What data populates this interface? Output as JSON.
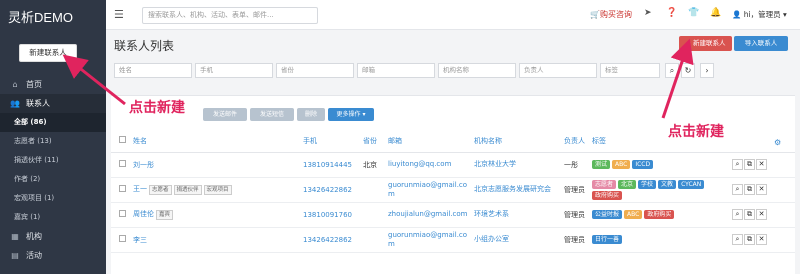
{
  "app": {
    "brand": "灵析DEMO",
    "new_contact": "新建联系人"
  },
  "sidebar": {
    "items": [
      {
        "label": "首页",
        "icon": "home-icon"
      },
      {
        "label": "联系人",
        "icon": "users-icon"
      }
    ],
    "sub": [
      "全部 (86)",
      "志愿者 (13)",
      "捐透伙伴 (11)",
      "作者 (2)",
      "宏观项目 (1)",
      "嘉宾 (1)"
    ],
    "items2": [
      {
        "label": "机构",
        "icon": "building-icon"
      },
      {
        "label": "活动",
        "icon": "calendar-icon"
      }
    ]
  },
  "header": {
    "search_placeholder": "搜索联系人、机构、活动、表单、邮件...",
    "buy": "购买咨询",
    "user": "hi，管理员"
  },
  "page": {
    "title": "联系人列表",
    "new_btn": "+ 新建联系人",
    "import_btn": "导入联系人"
  },
  "filters": [
    "姓名",
    "手机",
    "省份",
    "邮箱",
    "机构名称",
    "负责人",
    "标签"
  ],
  "toolbar": {
    "b1": "发送邮件",
    "b2": "发送短信",
    "b3": "删除",
    "more": "更多操作 ▾"
  },
  "table": {
    "headers": [
      "姓名",
      "手机",
      "省份",
      "邮箱",
      "机构名称",
      "负责人",
      "标签"
    ],
    "rows": [
      {
        "name": "刘一彤",
        "minis": [],
        "phone": "13810914445",
        "prov": "北京",
        "email": "liuyitong@qq.com",
        "org": "北京林业大学",
        "owner": "一彤",
        "tags": [
          "测试",
          "ABC",
          "ICCD"
        ]
      },
      {
        "name": "王一",
        "minis": [
          "志愿者",
          "捐透伙伴",
          "宏观项目"
        ],
        "phone": "13426422862",
        "prov": "",
        "email": "guorunmiao@gmail.com",
        "org": "北京志愿服务发展研究会",
        "owner": "管理员",
        "tags": [
          "志愿者",
          "北京",
          "学校",
          "文教",
          "CYCAN",
          "政府购买"
        ]
      },
      {
        "name": "周佳伦",
        "minis": [
          "嘉宾"
        ],
        "phone": "13810091760",
        "prov": "",
        "email": "zhoujialun@gmail.com",
        "org": "环境艺术系",
        "owner": "管理员",
        "tags": [
          "公益时报",
          "ABC",
          "政府购买"
        ]
      },
      {
        "name": "李三",
        "minis": [],
        "phone": "13426422862",
        "prov": "",
        "email": "guorunmiao@gmail.com",
        "org": "小组办公室",
        "owner": "管理员",
        "tags": [
          "日行一善"
        ]
      }
    ]
  },
  "annotations": [
    "点击新建",
    "点击新建"
  ],
  "colors": {
    "sidebar": "#2f3745",
    "accent": "#3a8bd1",
    "danger": "#d9534f",
    "callout": "#e0245e"
  }
}
